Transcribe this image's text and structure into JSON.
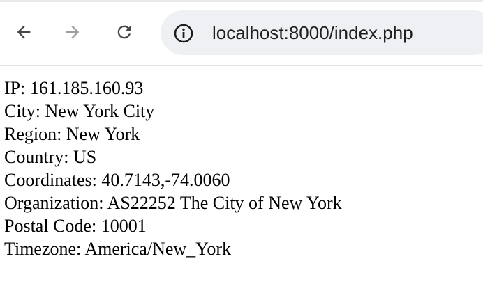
{
  "browser": {
    "url": "localhost:8000/index.php",
    "icons": {
      "back": "back-arrow-icon",
      "forward": "forward-arrow-icon",
      "reload": "reload-icon",
      "site_info": "info-icon"
    }
  },
  "page": {
    "lines": [
      {
        "label": "IP",
        "value": "161.185.160.93"
      },
      {
        "label": "City",
        "value": "New York City"
      },
      {
        "label": "Region",
        "value": "New York"
      },
      {
        "label": "Country",
        "value": "US"
      },
      {
        "label": "Coordinates",
        "value": "40.7143,-74.0060"
      },
      {
        "label": "Organization",
        "value": "AS22252 The City of New York"
      },
      {
        "label": "Postal Code",
        "value": "10001"
      },
      {
        "label": "Timezone",
        "value": "America/New_York"
      }
    ]
  }
}
